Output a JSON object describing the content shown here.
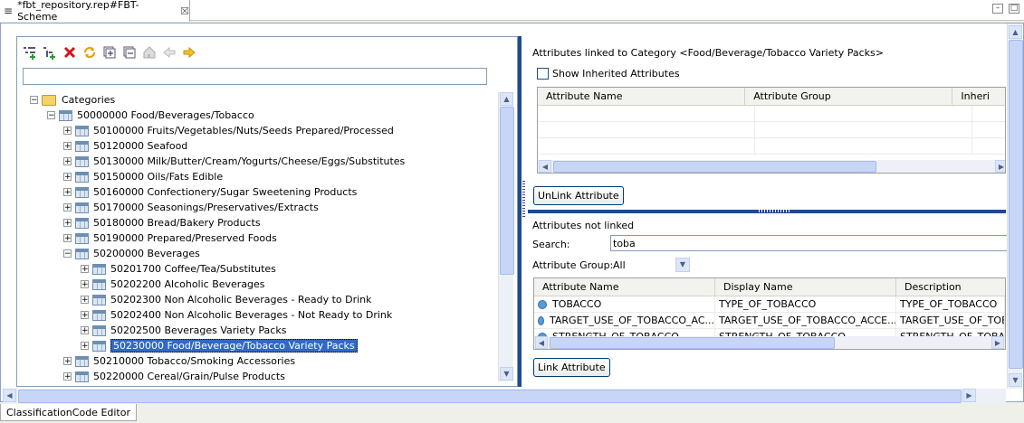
{
  "tab": {
    "title": "*fbt_repository.rep#FBT-Scheme",
    "close": "☒"
  },
  "window_controls": {
    "minimize": "–",
    "maximize": "□"
  },
  "toolbar_icons": [
    "add-sibling-icon",
    "add-child-icon",
    "delete-icon",
    "refresh-icon",
    "expand-all-icon",
    "collapse-all-icon",
    "home-icon",
    "back-icon",
    "forward-icon"
  ],
  "tree": {
    "root": "Categories",
    "items": [
      {
        "label": "50000000 Food/Beverages/Tobacco",
        "level": 1,
        "expanded": true
      },
      {
        "label": "50100000 Fruits/Vegetables/Nuts/Seeds Prepared/Processed",
        "level": 2
      },
      {
        "label": "50120000 Seafood",
        "level": 2
      },
      {
        "label": "50130000 Milk/Butter/Cream/Yogurts/Cheese/Eggs/Substitutes",
        "level": 2
      },
      {
        "label": "50150000 Oils/Fats Edible",
        "level": 2
      },
      {
        "label": "50160000 Confectionery/Sugar Sweetening Products",
        "level": 2
      },
      {
        "label": "50170000 Seasonings/Preservatives/Extracts",
        "level": 2
      },
      {
        "label": "50180000 Bread/Bakery Products",
        "level": 2
      },
      {
        "label": "50190000 Prepared/Preserved Foods",
        "level": 2
      },
      {
        "label": "50200000 Beverages",
        "level": 2,
        "expanded": true
      },
      {
        "label": "50201700 Coffee/Tea/Substitutes",
        "level": 3
      },
      {
        "label": "50202200 Alcoholic Beverages",
        "level": 3
      },
      {
        "label": "50202300 Non Alcoholic Beverages - Ready to Drink",
        "level": 3
      },
      {
        "label": "50202400 Non Alcoholic Beverages - Not Ready to Drink",
        "level": 3
      },
      {
        "label": "50202500 Beverages Variety Packs",
        "level": 3
      },
      {
        "label": "50230000 Food/Beverage/Tobacco Variety Packs",
        "level": 3,
        "selected": true
      },
      {
        "label": "50210000 Tobacco/Smoking Accessories",
        "level": 2
      },
      {
        "label": "50220000 Cereal/Grain/Pulse Products",
        "level": 2
      }
    ]
  },
  "linked": {
    "title": "Attributes linked to Category <Food/Beverage/Tobacco Variety Packs>",
    "show_inherited": "Show Inherited Attributes",
    "columns": [
      "Attribute Name",
      "Attribute Group",
      "Inheri"
    ],
    "unlink_button": "UnLink Attribute"
  },
  "not_linked": {
    "title": "Attributes not linked",
    "search_label": "Search:",
    "search_value": "toba",
    "group_label": "Attribute Group:",
    "group_value": "All",
    "columns": [
      "Attribute Name",
      "Display Name",
      "Description"
    ],
    "rows": [
      [
        "TOBACCO",
        "TYPE_OF_TOBACCO",
        "TYPE_OF_TOBACCO"
      ],
      [
        "TARGET_USE_OF_TOBACCO_AC...",
        "TARGET_USE_OF_TOBACCO_ACCE...",
        "TARGET_USE_OF_TOB"
      ],
      [
        "STRENGTH_OF_TOBACCO",
        "STRENGTH_OF_TOBACCO",
        "STRENGTH_OF_TOBA"
      ]
    ],
    "link_button": "Link Attribute"
  },
  "status_tab": "ClassificationCode Editor"
}
